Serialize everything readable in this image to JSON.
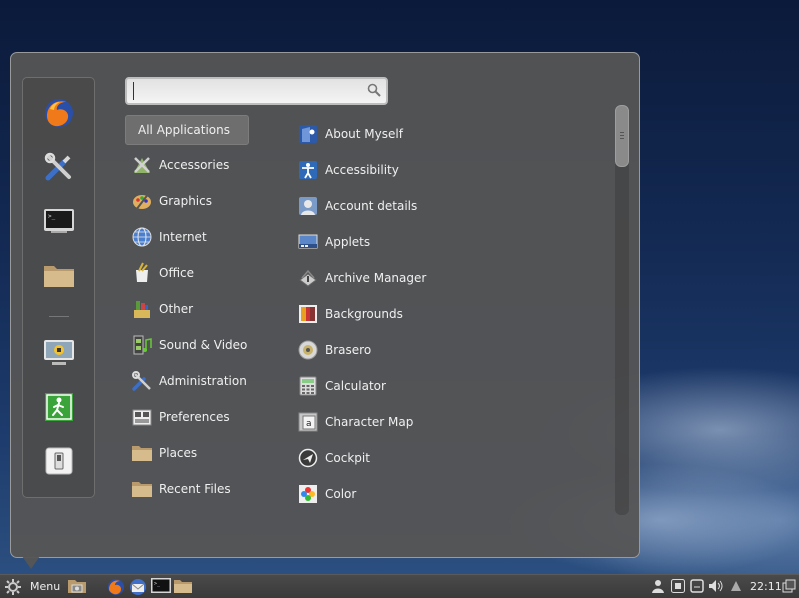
{
  "search": {
    "value": "",
    "placeholder": ""
  },
  "categories": [
    {
      "label": "All Applications",
      "icon": "none"
    },
    {
      "label": "Accessories",
      "icon": "accessories-icon"
    },
    {
      "label": "Graphics",
      "icon": "graphics-icon"
    },
    {
      "label": "Internet",
      "icon": "internet-globe-icon"
    },
    {
      "label": "Office",
      "icon": "office-icon"
    },
    {
      "label": "Other",
      "icon": "other-icon"
    },
    {
      "label": "Sound & Video",
      "icon": "sound-video-icon"
    },
    {
      "label": "Administration",
      "icon": "administration-icon"
    },
    {
      "label": "Preferences",
      "icon": "preferences-icon"
    },
    {
      "label": "Places",
      "icon": "folder-icon"
    },
    {
      "label": "Recent Files",
      "icon": "folder-icon"
    }
  ],
  "applications": [
    {
      "label": "About Myself",
      "icon": "about-myself-icon"
    },
    {
      "label": "Accessibility",
      "icon": "accessibility-icon"
    },
    {
      "label": "Account details",
      "icon": "account-details-icon"
    },
    {
      "label": "Applets",
      "icon": "applets-icon"
    },
    {
      "label": "Archive Manager",
      "icon": "archive-manager-icon"
    },
    {
      "label": "Backgrounds",
      "icon": "backgrounds-icon"
    },
    {
      "label": "Brasero",
      "icon": "brasero-disc-icon"
    },
    {
      "label": "Calculator",
      "icon": "calculator-icon"
    },
    {
      "label": "Character Map",
      "icon": "character-map-icon"
    },
    {
      "label": "Cockpit",
      "icon": "cockpit-icon"
    },
    {
      "label": "Color",
      "icon": "color-icon"
    }
  ],
  "favorites": [
    "firefox-icon",
    "system-tools-icon",
    "terminal-icon",
    "files-folder-icon",
    "lock-screen-icon",
    "logout-icon",
    "shutdown-icon"
  ],
  "taskbar": {
    "menu_label": "Menu",
    "clock": "22:11"
  },
  "colors": {
    "panel": "#555555",
    "accent": "#6e6e6e",
    "taskbar": "#404040"
  }
}
